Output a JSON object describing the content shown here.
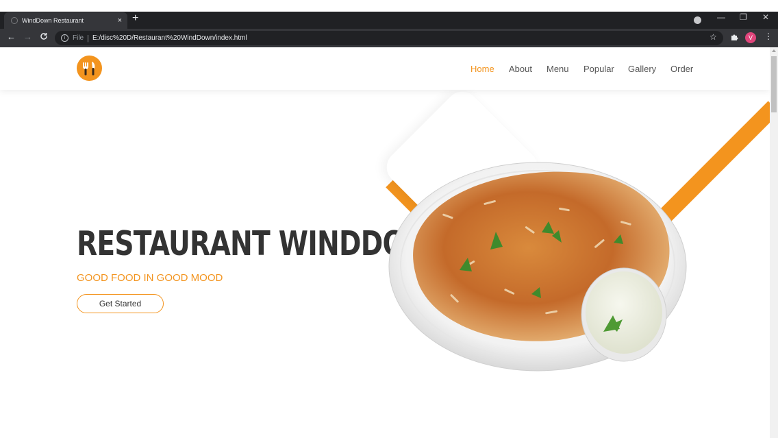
{
  "browser": {
    "tab_title": "WindDown Restaurant",
    "tab_close": "×",
    "new_tab": "+",
    "window_controls": {
      "minimize": "—",
      "restore": "❐",
      "close": "✕"
    },
    "nav_back": "←",
    "nav_forward": "→",
    "reload": "C",
    "address": {
      "scheme_label": "File",
      "separator": "|",
      "url": "E:/disc%20D/Restaurant%20WindDown/index.html"
    },
    "bookmark_icon": "☆",
    "extensions_icon": "puzzle-icon",
    "profile_initial": "V",
    "menu_icon": "⋮"
  },
  "site": {
    "logo_icon": "fork-knife-icon",
    "nav": {
      "items": [
        {
          "label": "Home",
          "active": true
        },
        {
          "label": "About",
          "active": false
        },
        {
          "label": "Menu",
          "active": false
        },
        {
          "label": "Popular",
          "active": false
        },
        {
          "label": "Gallery",
          "active": false
        },
        {
          "label": "Order",
          "active": false
        }
      ]
    },
    "hero": {
      "title": "RESTAURANT WINDDOWN",
      "subtitle": "GOOD FOOD IN GOOD MOOD",
      "cta_label": "Get Started",
      "image_icon": "biryani-plate-image"
    }
  },
  "colors": {
    "accent": "#f3941e",
    "heading": "#333333",
    "chrome_dark": "#202124",
    "chrome_mid": "#35363a"
  }
}
